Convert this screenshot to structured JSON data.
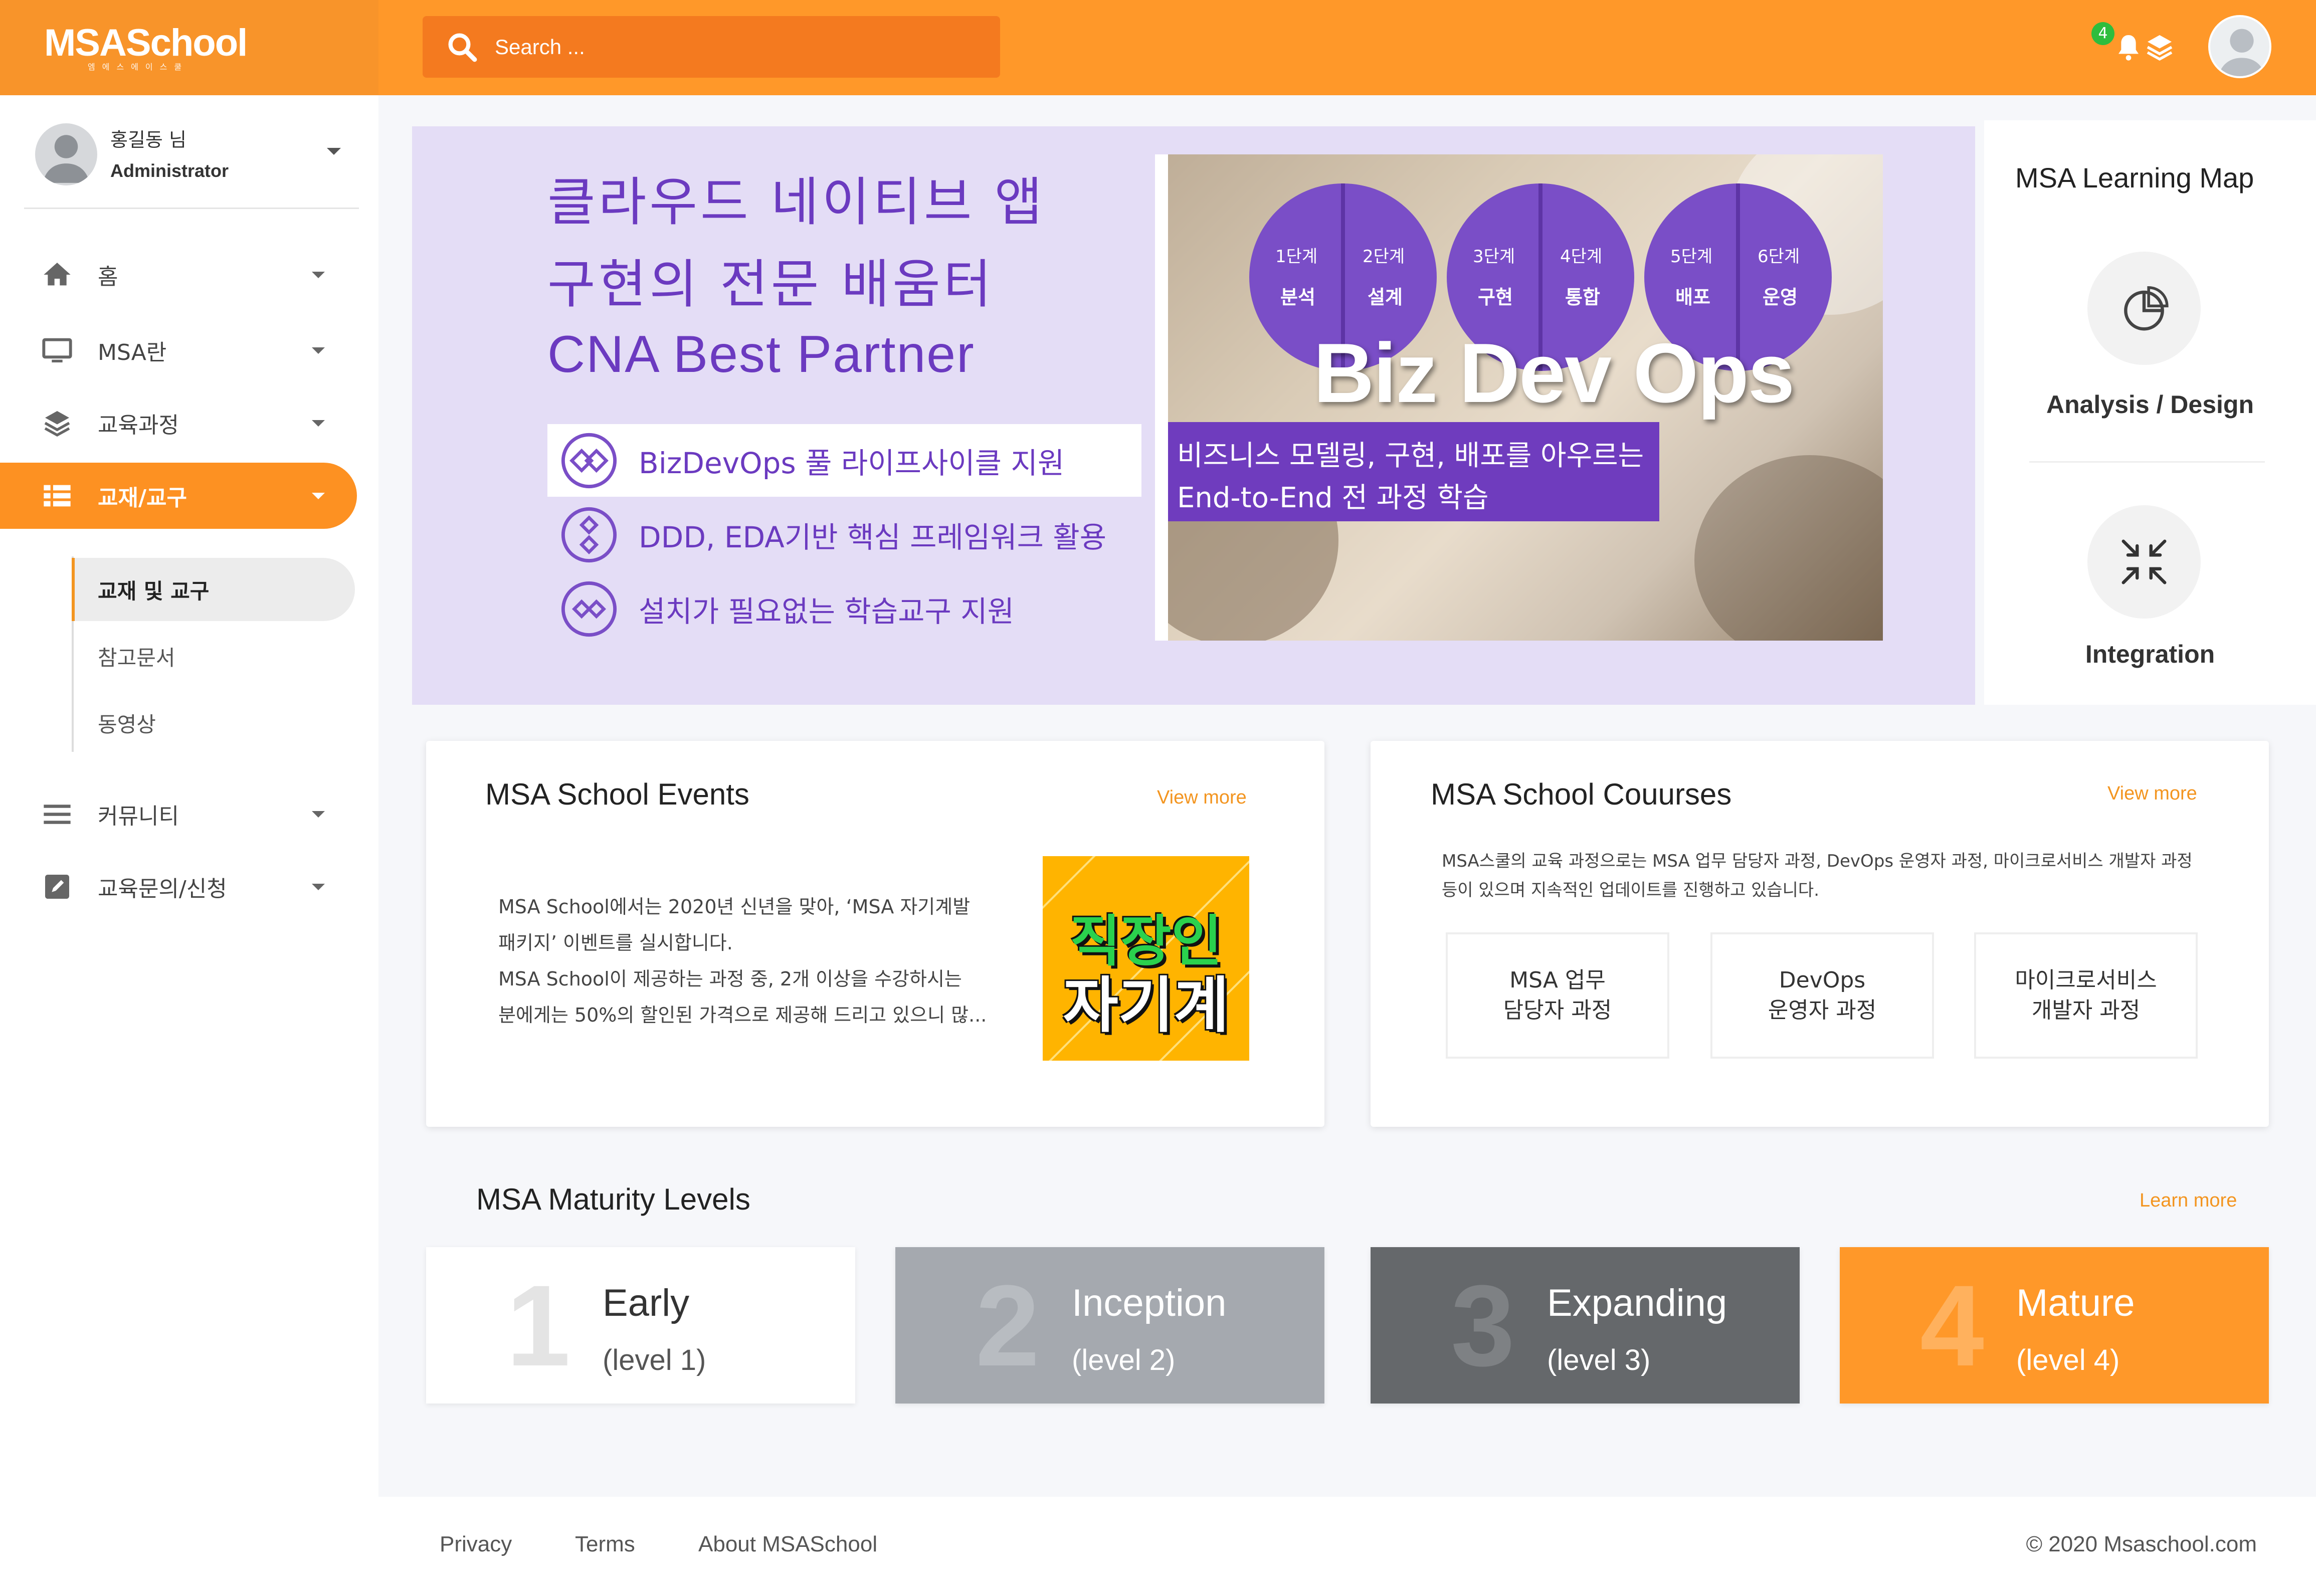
{
  "brand": {
    "logo": "MSASchool",
    "logo_sub": "엠에스에이스쿨"
  },
  "search": {
    "placeholder": "Search ..."
  },
  "header": {
    "notification_count": "4"
  },
  "profile": {
    "name": "홍길동 님",
    "role": "Administrator"
  },
  "sidebar": {
    "items": [
      {
        "label": "홈",
        "icon": "home-icon"
      },
      {
        "label": "MSA란",
        "icon": "monitor-icon"
      },
      {
        "label": "교육과정",
        "icon": "layers-icon"
      },
      {
        "label": "교재/교구",
        "icon": "list-icon",
        "active": true
      },
      {
        "label": "커뮤니티",
        "icon": "menu-icon"
      },
      {
        "label": "교육문의/신청",
        "icon": "edit-icon"
      }
    ],
    "subitems": [
      {
        "label": "교재 및 교구",
        "active": true
      },
      {
        "label": "참고문서"
      },
      {
        "label": "동영상"
      }
    ]
  },
  "hero": {
    "lines": [
      "클라우드 네이티브 앱",
      "구현의 전문 배움터",
      "CNA Best Partner"
    ],
    "features": [
      "BizDevOps 풀 라이프사이클 지원",
      "DDD, EDA기반 핵심 프레임워크 활용",
      "설치가 필요없는 학습교구 지원"
    ],
    "stages": [
      {
        "a": "1단계",
        "a_sub": "분석",
        "b": "2단계",
        "b_sub": "설계"
      },
      {
        "a": "3단계",
        "a_sub": "구현",
        "b": "4단계",
        "b_sub": "통합"
      },
      {
        "a": "5단계",
        "a_sub": "배포",
        "b": "6단계",
        "b_sub": "운영"
      }
    ],
    "banner_title": "Biz Dev Ops",
    "banner_text_1": "비즈니스 모델링, 구현, 배포를 아우르는",
    "banner_text_2": "End-to-End 전 과정 학습",
    "colors": {
      "purple": "#6b3ac0",
      "hero_bg": "#e4ddf6"
    }
  },
  "learning_map": {
    "title": "MSA Learning Map",
    "items": [
      {
        "label": "Analysis / Design",
        "icon": "pie-chart-icon"
      },
      {
        "label": "Integration",
        "icon": "compress-arrows-icon"
      }
    ]
  },
  "events": {
    "title": "MSA School Events",
    "more": "View more",
    "text": [
      "MSA School에서는 2020년 신년을 맞아, ‘MSA 자기계발",
      "패키지’ 이벤트를 실시합니다.",
      "MSA School이 제공하는 과정 중, 2개 이상을 수강하시는",
      "분에게는 50%의 할인된 가격으로 제공해 드리고 있으니 많..."
    ],
    "image_text_1": "직장인",
    "image_text_2": "자기계발"
  },
  "courses": {
    "title": "MSA School Couurses",
    "more": "View more",
    "desc": [
      "MSA스쿨의 교육 과정으로는 MSA 업무 담당자 과정,  DevOps 운영자 과정, 마이크로서비스 개발자 과정",
      "등이 있으며 지속적인 업데이트를 진행하고 있습니다."
    ],
    "boxes": [
      {
        "line1": "MSA 업무",
        "line2": "담당자 과정"
      },
      {
        "line1": "DevOps",
        "line2": "운영자 과정"
      },
      {
        "line1": "마이크로서비스",
        "line2": "개발자 과정"
      }
    ]
  },
  "maturity": {
    "title": "MSA Maturity Levels",
    "more": "Learn more",
    "levels": [
      {
        "num": "1",
        "name": "Early",
        "sub": "(level 1)",
        "bg": "#ffffff"
      },
      {
        "num": "2",
        "name": "Inception",
        "sub": "(level 2)",
        "bg": "#a5a9af"
      },
      {
        "num": "3",
        "name": "Expanding",
        "sub": "(level 3)",
        "bg": "#65686b"
      },
      {
        "num": "4",
        "name": "Mature",
        "sub": "(level 4)",
        "bg": "#ff9829"
      }
    ]
  },
  "footer": {
    "links": [
      "Privacy",
      "Terms",
      "About MSASchool"
    ],
    "copyright": "© 2020 Msaschool.com"
  }
}
